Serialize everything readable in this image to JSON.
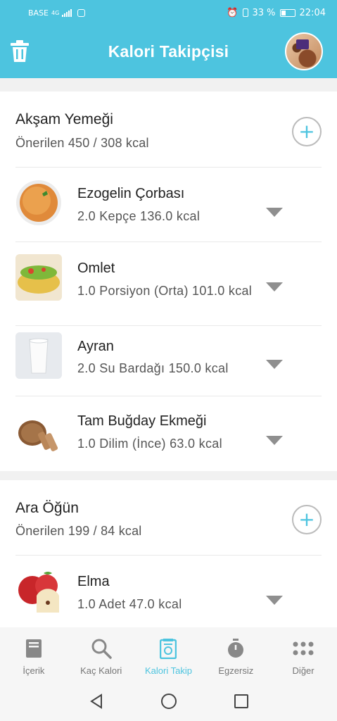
{
  "status_bar": {
    "carrier": "BASE",
    "network": "4G",
    "battery": "33 %",
    "time": "22:04"
  },
  "app_bar": {
    "title": "Kalori Takipçisi",
    "left_icon": "trash-icon",
    "right_icon": "profile-avatar"
  },
  "meals": [
    {
      "title": "Akşam Yemeği",
      "subtitle": "Önerilen 450 / 308 kcal",
      "add_icon": "plus-icon",
      "items": [
        {
          "name": "Ezogelin Çorbası",
          "detail": "2.0 Kepçe 136.0 kcal"
        },
        {
          "name": "Omlet",
          "detail": "1.0 Porsiyon (Orta) 101.0 kcal"
        },
        {
          "name": "Ayran",
          "detail": "2.0 Su Bardağı 150.0 kcal"
        },
        {
          "name": "Tam Buğday Ekmeği",
          "detail": "1.0 Dilim (İnce) 63.0 kcal"
        }
      ]
    },
    {
      "title": "Ara Öğün",
      "subtitle": "Önerilen 199 / 84 kcal",
      "add_icon": "plus-icon",
      "items": [
        {
          "name": "Elma",
          "detail": "1.0 Adet 47.0 kcal"
        }
      ]
    }
  ],
  "bottom_nav": [
    {
      "label": "İçerik",
      "icon": "book-icon"
    },
    {
      "label": "Kaç Kalori",
      "icon": "search-icon"
    },
    {
      "label": "Kalori Takip",
      "icon": "scale-icon",
      "active": true
    },
    {
      "label": "Egzersiz",
      "icon": "stopwatch-icon"
    },
    {
      "label": "Diğer",
      "icon": "grid-dots-icon"
    }
  ],
  "system_nav": [
    "back-icon",
    "home-icon",
    "recents-icon"
  ],
  "colors": {
    "primary": "#4dc4df",
    "text": "#222222",
    "secondary_text": "#555555",
    "inactive": "#777777"
  }
}
